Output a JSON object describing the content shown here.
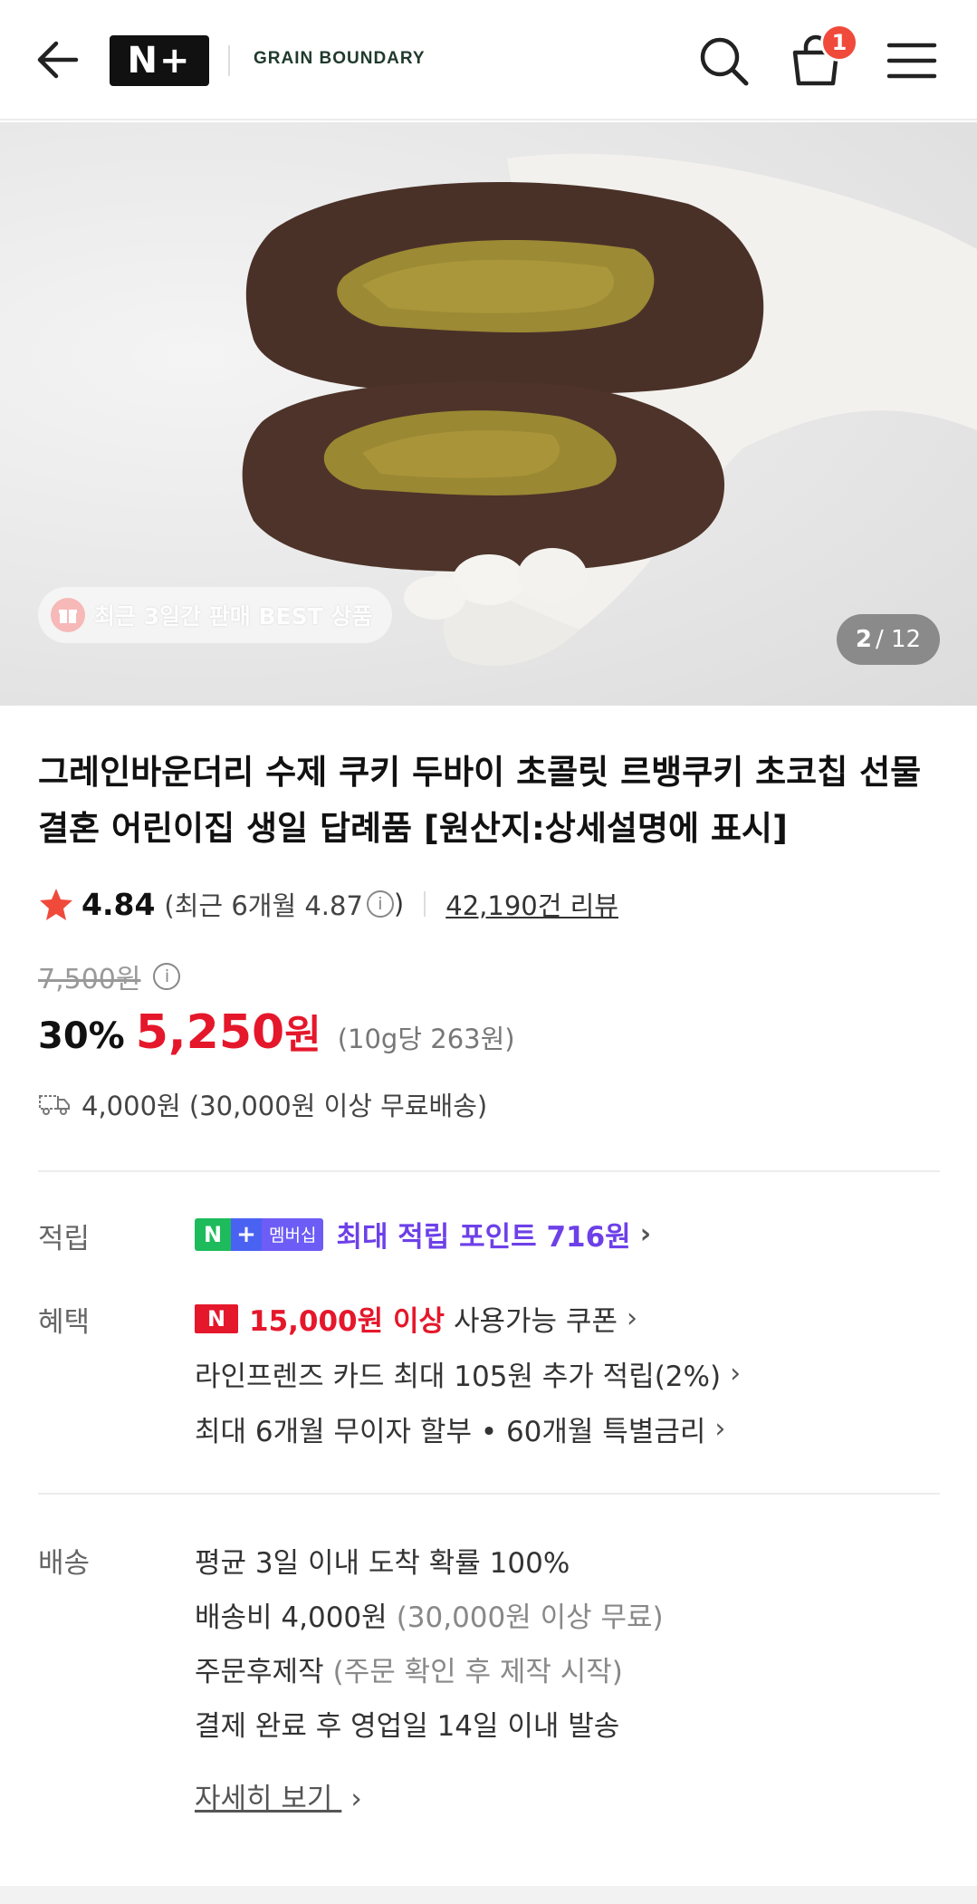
{
  "header": {
    "logo_text": "N+",
    "brand": "GRAIN BOUNDARY",
    "cart_count": "1"
  },
  "hero": {
    "best_badge": "최근 3일간 판매 BEST 상품",
    "pager_current": "2",
    "pager_total": "/ 12"
  },
  "product": {
    "title": "그레인바운더리 수제 쿠키 두바이 초콜릿 르뱅쿠키 초코칩 선물 결혼 어린이집 생일 답례품 [원산지:상세설명에 표시]",
    "rating": "4.84",
    "recent_rating": "(최근 6개월 4.87",
    "recent_close": ")",
    "reviews": "42,190건 리뷰",
    "original_price": "7,500원",
    "discount": "30%",
    "price": "5,250",
    "price_unit": "원",
    "unit_price": "(10g당 263원)",
    "shipping": "4,000원 (30,000원 이상 무료배송)"
  },
  "points": {
    "label": "적립",
    "tag_n": "N",
    "tag_plus": "+",
    "tag_member": "멤버십",
    "text": "최대 적립 포인트 716원"
  },
  "benefits": {
    "label": "혜택",
    "coupon_badge": "N",
    "coupon_min": "15,000원 이상",
    "coupon_text": "사용가능 쿠폰",
    "card": "라인프렌즈 카드 최대 105원 추가 적립(2%)",
    "installment": "최대 6개월 무이자 할부 • 60개월 특별금리"
  },
  "delivery": {
    "label": "배송",
    "line1": "평균 3일 이내 도착 확률 100%",
    "line2_main": "배송비 4,000원",
    "line2_sub": "(30,000원 이상 무료)",
    "line3_main": "주문후제작",
    "line3_sub": "(주문 확인 후 제작 시작)",
    "line4": "결제 완료 후 영업일 14일 이내 발송",
    "detail": "자세히 보기"
  },
  "colors": {
    "accent_red": "#e5172b",
    "membership_purple": "#6d40e8",
    "naver_green": "#1dbb5b"
  }
}
